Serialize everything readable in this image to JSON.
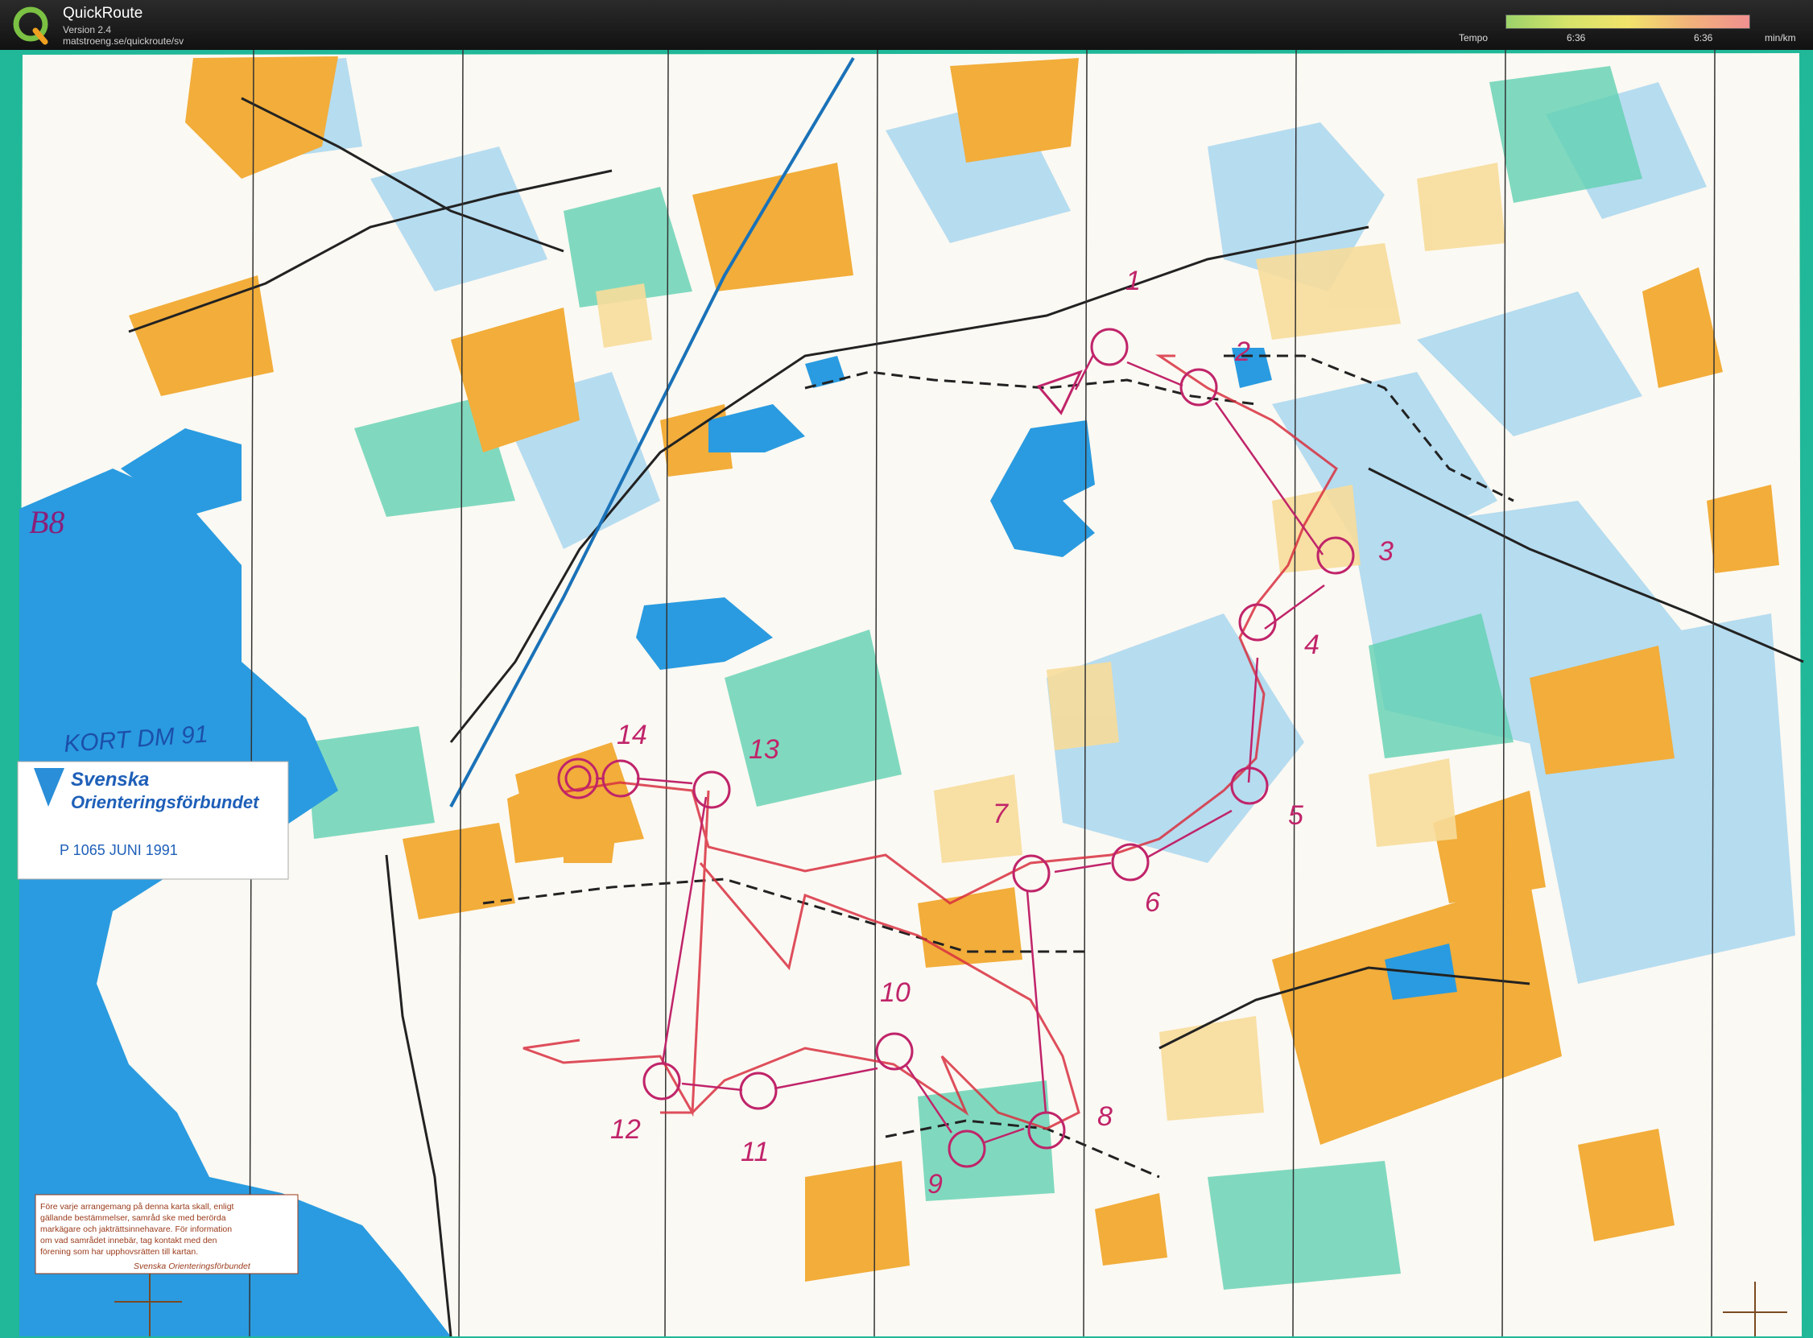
{
  "app": {
    "title": "QuickRoute",
    "version": "Version 2.4",
    "url": "matstroeng.se/quickroute/sv"
  },
  "legend": {
    "label": "Tempo",
    "min_value": "6:36",
    "max_value": "6:36",
    "unit": "min/km"
  },
  "map": {
    "class_label": "B8",
    "event_label": "KORT DM 91",
    "federation_logo_line1": "Svenska",
    "federation_logo_line2": "Orienteringsförbundet",
    "map_reference": "P 1065  JUNI 1991",
    "disclaimer_lines": [
      "Före varje arrangemang på denna karta skall, enligt",
      "gällande bestämmelser, samråd ske med berörda",
      "markägare och jakträttsinnehavare. För information",
      "om vad samrådet innebär, tag kontakt med den",
      "förening som har upphovsrätten till kartan."
    ],
    "disclaimer_signature": "Svenska Orienteringsförbundet",
    "control_numbers": [
      "1",
      "2",
      "3",
      "4",
      "5",
      "6",
      "7",
      "8",
      "9",
      "10",
      "11",
      "12",
      "13",
      "14"
    ],
    "colors": {
      "course": "#c0246a",
      "route": "#d8303f",
      "water": "#2a9be0",
      "open_land": "#f2ad3a",
      "green": "#5fcfb0",
      "marsh": "#9ed3ec"
    }
  }
}
